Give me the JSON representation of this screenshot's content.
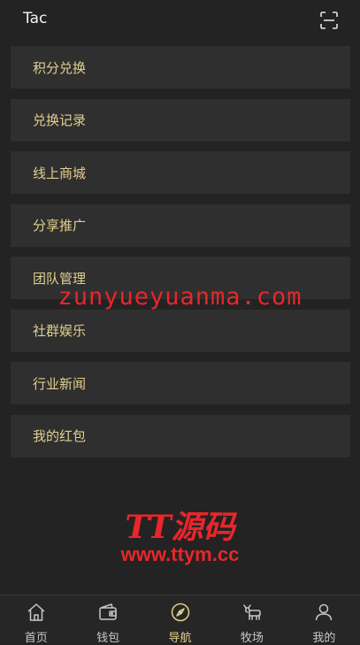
{
  "header": {
    "title": "Tac",
    "scan_icon": "scan-icon"
  },
  "menu": {
    "items": [
      {
        "label": "积分兑换"
      },
      {
        "label": "兑换记录"
      },
      {
        "label": "线上商城"
      },
      {
        "label": "分享推广"
      },
      {
        "label": "团队管理"
      },
      {
        "label": "社群娱乐"
      },
      {
        "label": "行业新闻"
      },
      {
        "label": "我的红包"
      }
    ]
  },
  "watermark": {
    "domain": "zunyueyuanma.com",
    "brand": "TT源码",
    "url": "www.ttym.cc"
  },
  "tabbar": {
    "active_index": 2,
    "items": [
      {
        "label": "首页",
        "icon": "home-icon"
      },
      {
        "label": "钱包",
        "icon": "wallet-icon"
      },
      {
        "label": "导航",
        "icon": "compass-icon"
      },
      {
        "label": "牧场",
        "icon": "cow-icon"
      },
      {
        "label": "我的",
        "icon": "user-icon"
      }
    ]
  },
  "colors": {
    "background": "#232323",
    "menu_item_bg": "#2f2f2f",
    "menu_text": "#e2cf8e",
    "tab_inactive": "#c8c8c8",
    "tab_active": "#e2cf8e",
    "watermark_red": "#e8262b"
  }
}
